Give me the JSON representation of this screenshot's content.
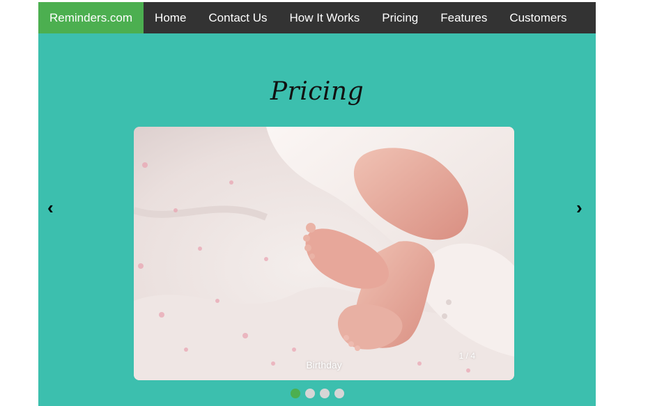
{
  "navbar": {
    "brand": "Reminders.com",
    "items": [
      {
        "label": "Home"
      },
      {
        "label": "Contact Us"
      },
      {
        "label": "How It Works"
      },
      {
        "label": "Pricing"
      },
      {
        "label": "Features"
      },
      {
        "label": "Customers"
      }
    ]
  },
  "page": {
    "title": "Pricing"
  },
  "slideshow": {
    "caption": "Birthday",
    "counter": "1 / 4",
    "prev_icon": "‹",
    "next_icon": "›",
    "current_slide": 1,
    "total_slides": 4
  },
  "colors": {
    "background": "#3cbfae",
    "navbar": "#333333",
    "brand": "#4caf50",
    "dot_active": "#4caf50",
    "dot_inactive": "#d6d6d6"
  }
}
